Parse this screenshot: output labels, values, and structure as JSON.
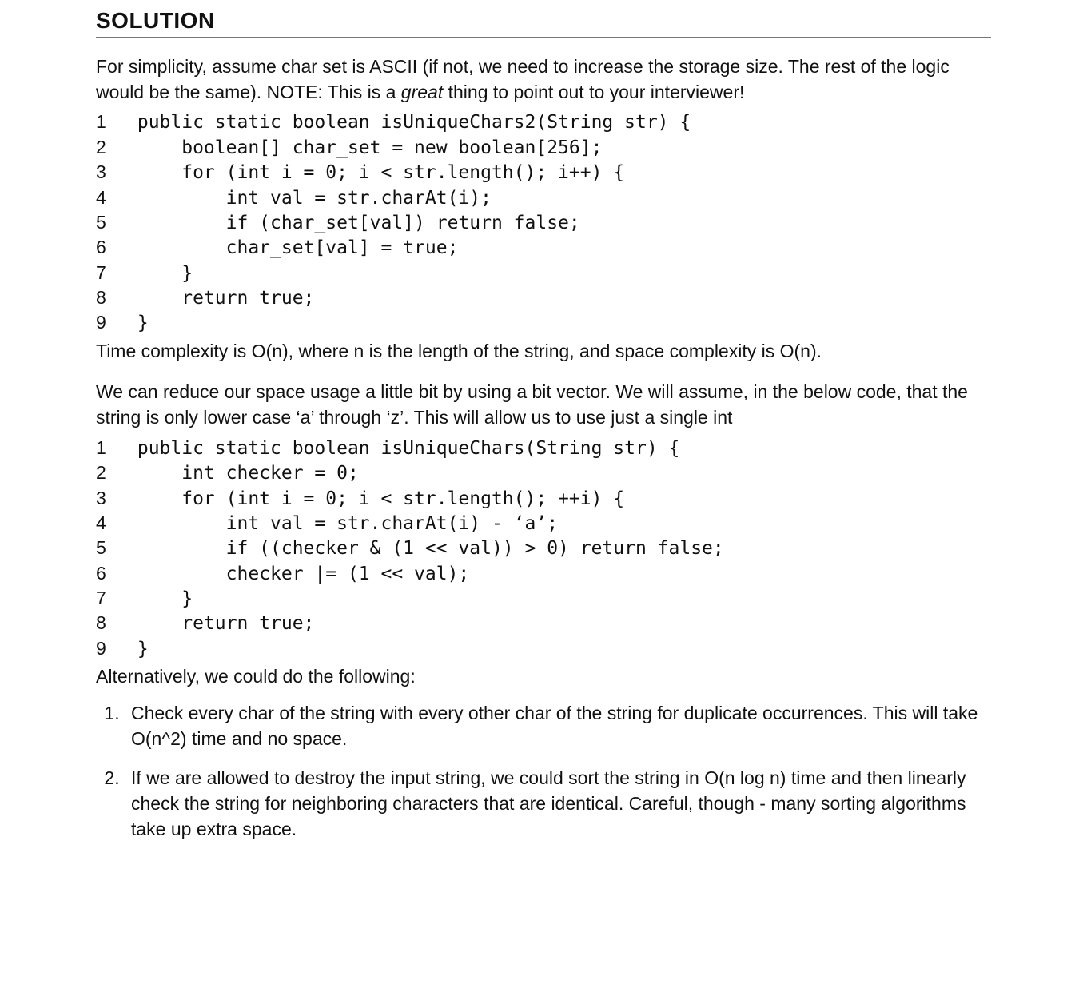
{
  "heading": "SOLUTION",
  "para1_html": "For simplicity, assume char set is ASCII (if not, we need to increase the storage size.  The rest of the logic would be the same). NOTE: This is a <em>great</em> thing to point out to your interviewer!",
  "code1": [
    {
      "n": "1",
      "c": " public static boolean isUniqueChars2(String str) {"
    },
    {
      "n": "2",
      "c": "     boolean[] char_set = new boolean[256];"
    },
    {
      "n": "3",
      "c": "     for (int i = 0; i < str.length(); i++) {"
    },
    {
      "n": "4",
      "c": "         int val = str.charAt(i);"
    },
    {
      "n": "5",
      "c": "         if (char_set[val]) return false;"
    },
    {
      "n": "6",
      "c": "         char_set[val] = true;"
    },
    {
      "n": "7",
      "c": "     }"
    },
    {
      "n": "8",
      "c": "     return true;"
    },
    {
      "n": "9",
      "c": " }"
    }
  ],
  "para2": "Time complexity is O(n), where n is the length of the string, and space complexity is O(n).",
  "para3": "We can reduce our space usage a little bit by using a bit vector.  We will assume, in the below code, that the string is only lower case ‘a’ through ‘z’.  This will allow us to use just a single int",
  "code2": [
    {
      "n": "1",
      "c": " public static boolean isUniqueChars(String str) {"
    },
    {
      "n": "2",
      "c": "     int checker = 0;"
    },
    {
      "n": "3",
      "c": "     for (int i = 0; i < str.length(); ++i) {"
    },
    {
      "n": "4",
      "c": "         int val = str.charAt(i) - ‘a’;"
    },
    {
      "n": "5",
      "c": "         if ((checker & (1 << val)) > 0) return false;"
    },
    {
      "n": "6",
      "c": "         checker |= (1 << val);"
    },
    {
      "n": "7",
      "c": "     }"
    },
    {
      "n": "8",
      "c": "     return true;"
    },
    {
      "n": "9",
      "c": " }"
    }
  ],
  "para4": "Alternatively, we could do the following:",
  "alt_list": [
    "Check every char of the string with every other char of the string for duplicate occurrences. This will take O(n^2) time and no space.",
    "If we are allowed to destroy the input string, we could sort the string in O(n log n) time and then linearly check the string for neighboring characters that are identical.  Careful, though - many sorting algorithms take up extra space."
  ]
}
